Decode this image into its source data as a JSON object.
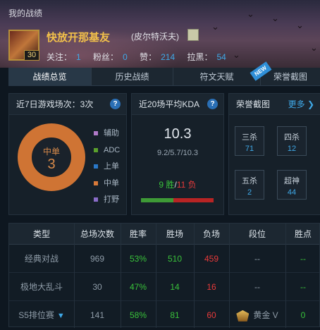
{
  "header": {
    "page_label": "我的战绩",
    "nickname": "快放开那基友",
    "server": "(皮尔特沃夫)",
    "level": "30",
    "follow_label": "关注：",
    "follow_count": "1",
    "fans_label": "粉丝：",
    "fans_count": "0",
    "likes_label": "赞：",
    "likes_count": "214",
    "blacklist_label": "拉黑：",
    "blacklist_count": "54"
  },
  "tabs": [
    {
      "label": "战绩总览",
      "active": true
    },
    {
      "label": "历史战绩",
      "active": false
    },
    {
      "label": "符文天赋",
      "active": false
    },
    {
      "label": "荣誉截图",
      "active": false
    }
  ],
  "new_badge": "NEW",
  "recent7": {
    "title": "近7日游戏场次：3次",
    "center_label": "中单",
    "center_count": "3",
    "legend": [
      {
        "label": "辅助",
        "color": "#b07ac8"
      },
      {
        "label": "ADC",
        "color": "#5aa02c"
      },
      {
        "label": "上单",
        "color": "#2a78c8"
      },
      {
        "label": "中单",
        "color": "#d87a3a"
      },
      {
        "label": "打野",
        "color": "#8a6cc8"
      }
    ]
  },
  "kda": {
    "title": "近20场平均KDA",
    "value": "10.3",
    "detail": "9.2/5.7/10.3",
    "wins": "9 胜",
    "slash": "/",
    "losses": "11 负",
    "win_fraction": 0.45
  },
  "glory": {
    "title": "荣誉截图",
    "more_label": "更多 ❯",
    "items": [
      {
        "label": "三杀",
        "value": "71"
      },
      {
        "label": "四杀",
        "value": "12"
      },
      {
        "label": "五杀",
        "value": "2"
      },
      {
        "label": "超神",
        "value": "44"
      }
    ]
  },
  "table": {
    "headers": [
      "类型",
      "总场次数",
      "胜率",
      "胜场",
      "负场",
      "段位",
      "胜点"
    ],
    "rows": [
      {
        "type": "经典对战",
        "total": "969",
        "rate": "53%",
        "wins": "510",
        "losses": "459",
        "tier": "--",
        "points": "--"
      },
      {
        "type": "极地大乱斗",
        "total": "30",
        "rate": "47%",
        "wins": "14",
        "losses": "16",
        "tier": "--",
        "points": "--"
      },
      {
        "type": "S5排位赛",
        "total": "141",
        "rate": "58%",
        "wins": "81",
        "losses": "60",
        "tier": "黄金 V",
        "points": "0"
      }
    ]
  },
  "icons": {
    "help": "help-icon",
    "tier": "gold-tier-icon",
    "expand": "chevron-down-icon"
  }
}
